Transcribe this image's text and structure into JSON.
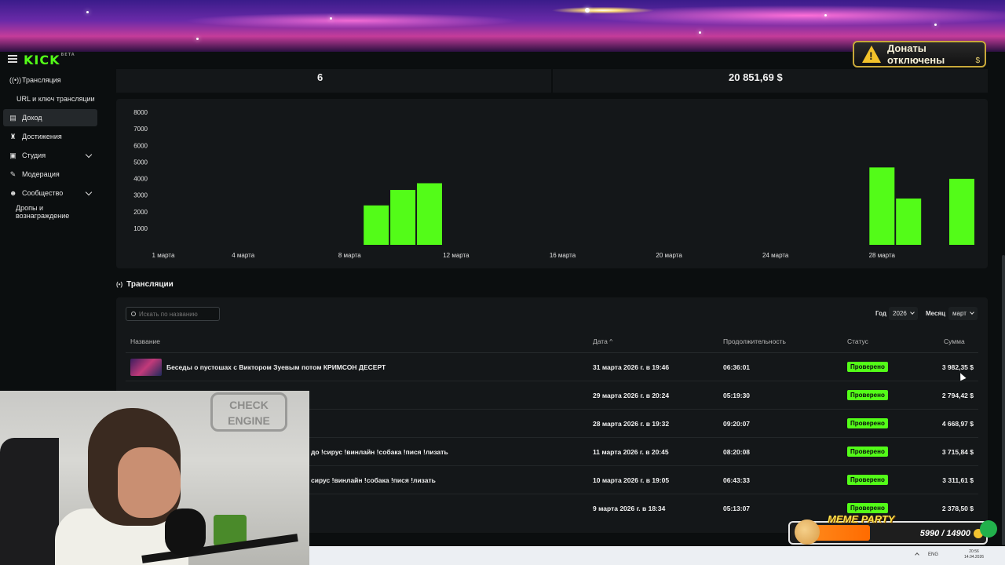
{
  "app": {
    "logo": "KICK"
  },
  "donations": {
    "label": "Донаты отключены",
    "currency_symbol": "$"
  },
  "sidebar": {
    "items": [
      {
        "label": "Трансляция",
        "icon": "broadcast-icon"
      },
      {
        "label": "URL и ключ трансляции",
        "icon": ""
      },
      {
        "label": "Доход",
        "icon": "chart-icon",
        "active": true
      },
      {
        "label": "Достижения",
        "icon": "trophy-icon"
      },
      {
        "label": "Студия",
        "icon": "studio-icon",
        "expandable": true
      },
      {
        "label": "Модерация",
        "icon": "wrench-icon"
      },
      {
        "label": "Сообщество",
        "icon": "community-icon",
        "expandable": true
      },
      {
        "label": "Дропы и вознаграждение",
        "icon": ""
      }
    ]
  },
  "stats": {
    "streams_count": "6",
    "total_amount": "20 851,69 $"
  },
  "chart_data": {
    "type": "bar",
    "color": "#53fc18",
    "yticks": [
      1000,
      2000,
      3000,
      4000,
      5000,
      6000,
      7000,
      8000
    ],
    "ylim": [
      0,
      8000
    ],
    "xtick_labels": [
      "1 марта",
      "4 марта",
      "8 марта",
      "12 марта",
      "16 марта",
      "20 марта",
      "24 марта",
      "28 марта"
    ],
    "bars": [
      {
        "x": "9 марта",
        "value": 2378.5
      },
      {
        "x": "10 марта",
        "value": 3311.61
      },
      {
        "x": "11 марта",
        "value": 3715.84
      },
      {
        "x": "28 марта",
        "value": 4668.97
      },
      {
        "x": "29 марта",
        "value": 2794.42
      },
      {
        "x": "31 марта",
        "value": 3982.35
      }
    ]
  },
  "streams": {
    "section_title": "Трансляции",
    "search_placeholder": "Искать по названию",
    "filters": {
      "year_label": "Год",
      "year_value": "2026",
      "month_label": "Месяц",
      "month_value": "март"
    },
    "columns": {
      "name": "Название",
      "date": "Дата",
      "duration": "Продолжительность",
      "status": "Статус",
      "sum": "Сумма"
    },
    "rows": [
      {
        "name": "Беседы о пустошах с Виктором Зуевым потом КРИМСОН ДЕСЕРТ",
        "date": "31 марта 2026 г. в 19:46",
        "duration": "06:36:01",
        "status": "Проверено",
        "sum": "3 982,35 $"
      },
      {
        "name": "",
        "date": "29 марта 2026 г. в 20:24",
        "duration": "05:19:30",
        "status": "Проверено",
        "sum": "2 794,42 $"
      },
      {
        "name": "",
        "date": "28 марта 2026 г. в 19:32",
        "duration": "09:20:07",
        "status": "Проверено",
        "sum": "4 668,97 $"
      },
      {
        "name": "до !сирус !винлайн !собака !пися !лизать",
        "date": "11 марта 2026 г. в 20:45",
        "duration": "08:20:08",
        "status": "Проверено",
        "sum": "3 715,84 $"
      },
      {
        "name": "сирус !винлайн !собака !пися !лизать",
        "date": "10 марта 2026 г. в 19:05",
        "duration": "06:43:33",
        "status": "Проверено",
        "sum": "3 311,61 $"
      },
      {
        "name": "",
        "date": "9 марта 2026 г. в 18:34",
        "duration": "05:13:07",
        "status": "Проверено",
        "sum": "2 378,50 $"
      }
    ]
  },
  "webcam": {
    "wall_logo": "CHECK ENGINE"
  },
  "overlay": {
    "meme_title": "MEME PARTY",
    "goal": "5990 / 14900"
  },
  "taskbar": {
    "lang": "ENG",
    "time": "20:56",
    "date": "14.04.2026"
  }
}
